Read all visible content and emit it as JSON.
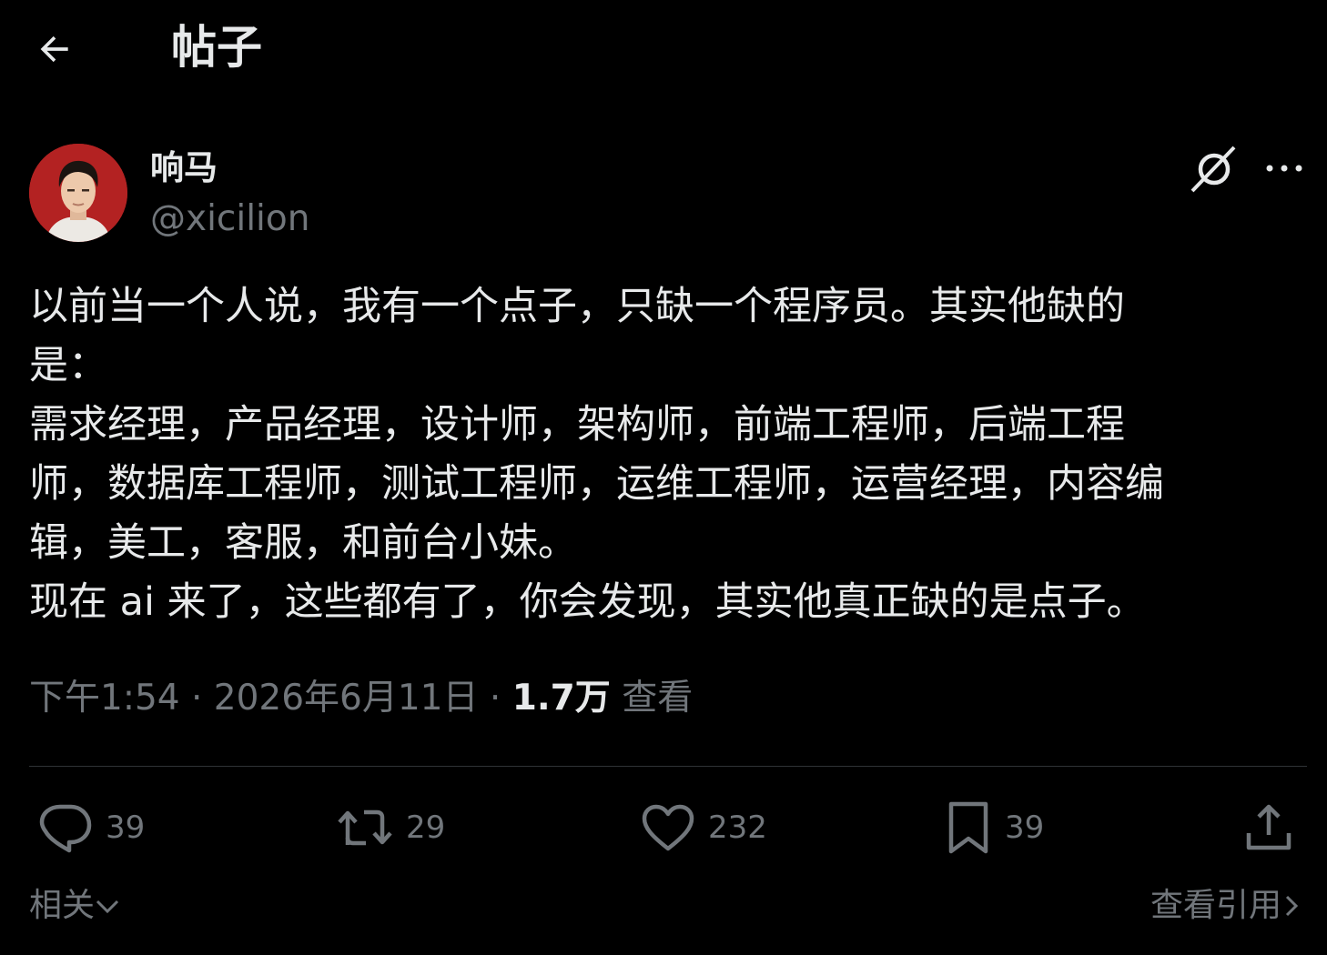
{
  "header": {
    "title": "帖子",
    "back_icon": "arrow-left-icon"
  },
  "author": {
    "name": "响马",
    "handle": "@xicilion"
  },
  "post": {
    "lines": [
      "以前当一个人说，我有一个点子，只缺一个程序员。其实他缺的",
      "是：",
      "需求经理，产品经理，设计师，架构师，前端工程师，后端工程",
      "师，数据库工程师，测试工程师，运维工程师，运营经理，内容编",
      "辑，美工，客服，和前台小妹。",
      "现在 ai 来了，这些都有了，你会发现，其实他真正缺的是点子。"
    ]
  },
  "meta": {
    "time": "下午1:54",
    "sep1": " · ",
    "date": "2026年6月11日",
    "sep2": " · ",
    "views_count": "1.7万",
    "views_label": " 查看"
  },
  "actions": {
    "replies": "39",
    "reposts": "29",
    "likes": "232",
    "bookmarks": "39"
  },
  "footer": {
    "related": "相关",
    "quotes": "查看引用"
  },
  "colors": {
    "background": "#000000",
    "text": "#e7e9ea",
    "muted": "#71767b",
    "divider": "#2f3336",
    "avatar_bg": "#b32222"
  }
}
